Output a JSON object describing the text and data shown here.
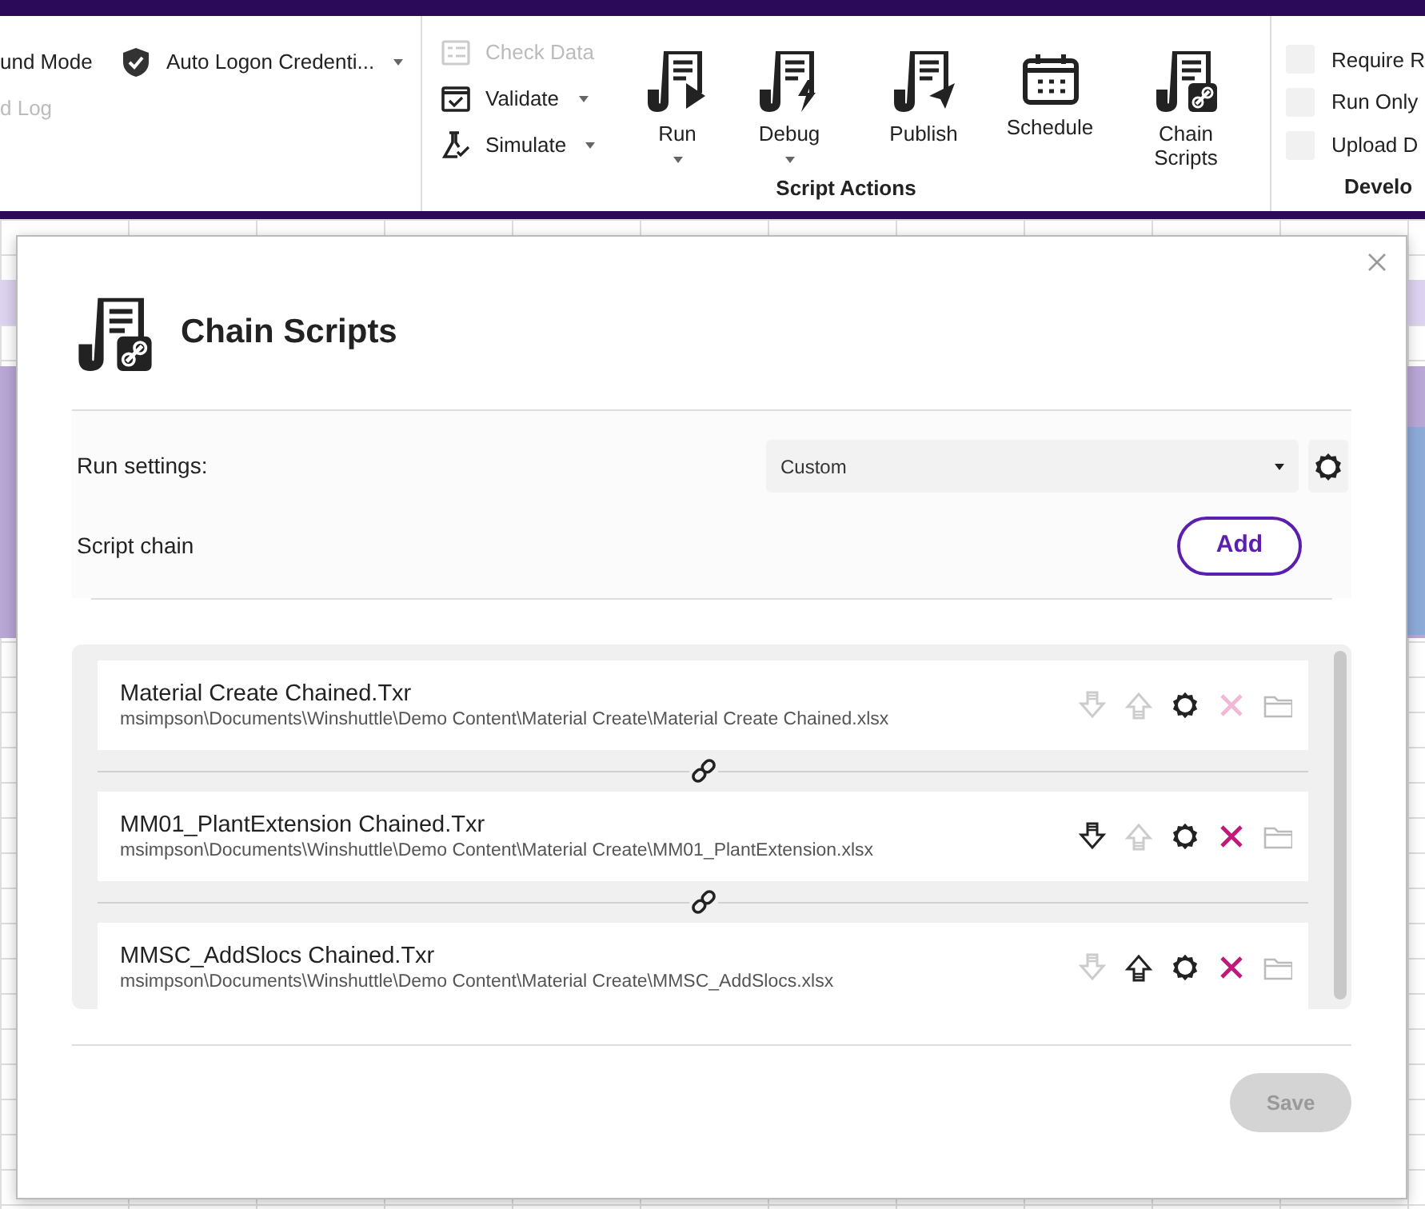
{
  "ribbon": {
    "left_group": {
      "items": [
        {
          "label": "und Mode",
          "disabled": false
        },
        {
          "label": "d Log",
          "disabled": true
        }
      ],
      "credentials": {
        "label": "Auto Logon Credenti..."
      }
    },
    "script_actions": {
      "small_buttons": [
        {
          "label": "Check Data",
          "kind": "check",
          "disabled": true,
          "dropdown": false
        },
        {
          "label": "Validate",
          "kind": "validate",
          "disabled": false,
          "dropdown": true
        },
        {
          "label": "Simulate",
          "kind": "simulate",
          "disabled": false,
          "dropdown": true
        }
      ],
      "large_buttons": [
        {
          "label": "Run",
          "kind": "run",
          "dropdown": true
        },
        {
          "label": "Debug",
          "kind": "debug",
          "dropdown": true
        },
        {
          "label": "Publish",
          "kind": "publish",
          "dropdown": false
        },
        {
          "label": "Schedule",
          "kind": "schedule",
          "dropdown": false
        },
        {
          "label": "Chain Scripts",
          "kind": "chain",
          "dropdown": false
        }
      ],
      "group_label": "Script Actions"
    },
    "develop": {
      "checkboxes": [
        {
          "label": "Require R",
          "checked": false
        },
        {
          "label": "Run Only",
          "checked": false
        },
        {
          "label": "Upload D",
          "checked": false
        }
      ],
      "group_label": "Develo"
    }
  },
  "dialog": {
    "title": "Chain Scripts",
    "run_settings": {
      "label": "Run settings:",
      "value": "Custom"
    },
    "script_chain": {
      "label": "Script chain",
      "add_button": "Add"
    },
    "scripts": [
      {
        "name": "Material Create Chained.Txr",
        "path": "msimpson\\Documents\\Winshuttle\\Demo Content\\Material Create\\Material Create Chained.xlsx",
        "can_move_down": false,
        "can_move_up": false,
        "can_remove": false,
        "can_open_folder": false
      },
      {
        "name": "MM01_PlantExtension Chained.Txr",
        "path": "msimpson\\Documents\\Winshuttle\\Demo Content\\Material Create\\MM01_PlantExtension.xlsx",
        "can_move_down": true,
        "can_move_up": false,
        "can_remove": true,
        "can_open_folder": false
      },
      {
        "name": "MMSC_AddSlocs Chained.Txr",
        "path": "msimpson\\Documents\\Winshuttle\\Demo Content\\Material Create\\MMSC_AddSlocs.xlsx",
        "can_move_down": false,
        "can_move_up": true,
        "can_remove": true,
        "can_open_folder": false
      }
    ],
    "save_button": {
      "label": "Save",
      "disabled": true
    }
  }
}
